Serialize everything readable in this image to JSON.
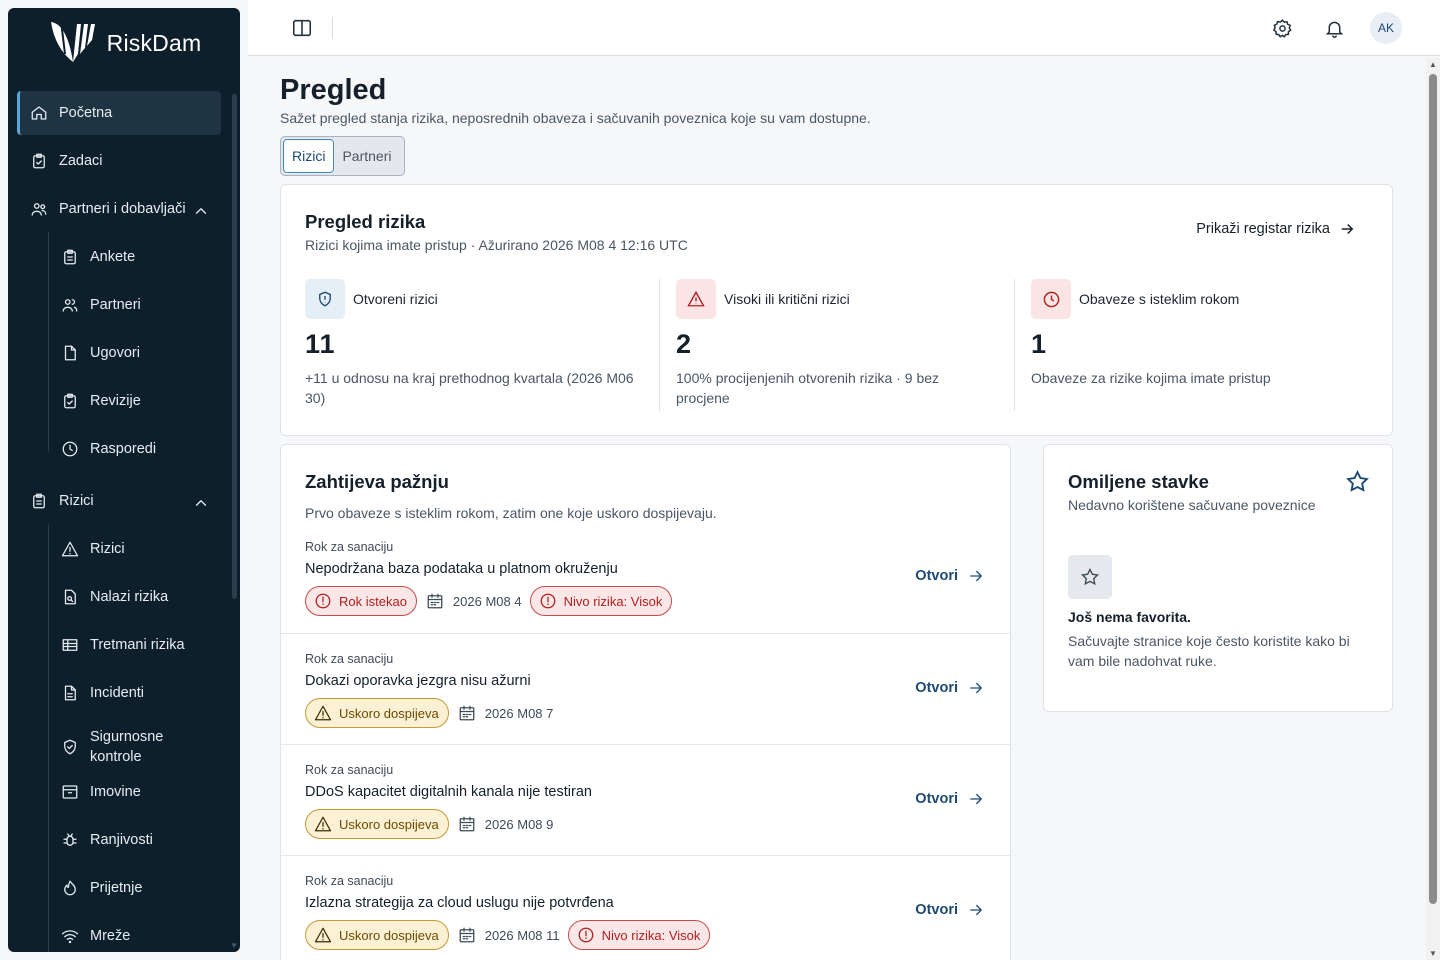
{
  "app": {
    "name": "RiskDam"
  },
  "sidebar": {
    "items": [
      {
        "label": "Početna",
        "icon": "home-icon",
        "active": true
      },
      {
        "label": "Zadaci",
        "icon": "clipboard-check-icon"
      },
      {
        "label": "Partneri i dobavljači",
        "icon": "users-icon",
        "expanded": true
      },
      {
        "label": "Ankete",
        "icon": "clipboard-list-icon"
      },
      {
        "label": "Partneri",
        "icon": "user-group-icon"
      },
      {
        "label": "Ugovori",
        "icon": "file-icon"
      },
      {
        "label": "Revizije",
        "icon": "clipboard-check-icon"
      },
      {
        "label": "Rasporedi",
        "icon": "clock-icon"
      },
      {
        "label": "Rizici",
        "icon": "clipboard-list-icon",
        "expanded": true
      },
      {
        "label": "Rizici",
        "icon": "warning-icon"
      },
      {
        "label": "Nalazi rizika",
        "icon": "file-search-icon"
      },
      {
        "label": "Tretmani rizika",
        "icon": "table-icon"
      },
      {
        "label": "Incidenti",
        "icon": "file-text-icon"
      },
      {
        "label": "Sigurnosne kontrole",
        "icon": "shield-check-icon"
      },
      {
        "label": "Imovine",
        "icon": "archive-icon"
      },
      {
        "label": "Ranjivosti",
        "icon": "bug-icon"
      },
      {
        "label": "Prijetnje",
        "icon": "flame-icon"
      },
      {
        "label": "Mreže",
        "icon": "wifi-icon"
      }
    ]
  },
  "topbar": {
    "avatar_initials": "AK"
  },
  "page": {
    "title": "Pregled",
    "subtitle": "Sažet pregled stanja rizika, neposrednih obaveza i sačuvanih poveznica koje su vam dostupne.",
    "tabs": [
      {
        "label": "Rizici",
        "selected": true
      },
      {
        "label": "Partneri",
        "selected": false
      }
    ]
  },
  "risk_overview": {
    "title": "Pregled rizika",
    "subtitle": "Rizici kojima imate pristup · Ažurirano 2026 M08 4 12:16 UTC",
    "link": "Prikaži registar rizika",
    "metrics": [
      {
        "label": "Otvoreni rizici",
        "value": "11",
        "note": "+11 u odnosu na kraj prethodnog kvartala (2026 M06 30)",
        "icon": "shield-alert-icon",
        "tint": "#e4eff8",
        "color": "#1d4a73"
      },
      {
        "label": "Visoki ili kritični rizici",
        "value": "2",
        "note": "100% procijenjenih otvorenih rizika · 9 bez procjene",
        "icon": "warning-icon",
        "tint": "#fbe4e4",
        "color": "#b21f1f"
      },
      {
        "label": "Obaveze s isteklim rokom",
        "value": "1",
        "note": "Obaveze za rizike kojima imate pristup",
        "icon": "clock-icon",
        "tint": "#fbe4e4",
        "color": "#b21f1f"
      }
    ]
  },
  "attention": {
    "title": "Zahtijeva pažnju",
    "subtitle": "Prvo obaveze s isteklim rokom, zatim one koje uskoro dospijevaju.",
    "open_label": "Otvori",
    "items": [
      {
        "kind": "Rok za sanaciju",
        "title": "Nepodržana baza podataka u platnom okruženju",
        "status": "Rok istekao",
        "status_tone": "red",
        "date": "2026 M08 4",
        "level": "Nivo rizika: Visok"
      },
      {
        "kind": "Rok za sanaciju",
        "title": "Dokazi oporavka jezgra nisu ažurni",
        "status": "Uskoro dospijeva",
        "status_tone": "amber",
        "date": "2026 M08 7",
        "level": ""
      },
      {
        "kind": "Rok za sanaciju",
        "title": "DDoS kapacitet digitalnih kanala nije testiran",
        "status": "Uskoro dospijeva",
        "status_tone": "amber",
        "date": "2026 M08 9",
        "level": ""
      },
      {
        "kind": "Rok za sanaciju",
        "title": "Izlazna strategija za cloud uslugu nije potvrđena",
        "status": "Uskoro dospijeva",
        "status_tone": "amber",
        "date": "2026 M08 11",
        "level": "Nivo rizika: Visok"
      }
    ]
  },
  "favorites": {
    "title": "Omiljene stavke",
    "subtitle": "Nedavno korištene sačuvane poveznice",
    "empty_title": "Još nema favorita.",
    "empty_text": "Sačuvajte stranice koje često koristite kako bi vam bile nadohvat ruke."
  }
}
